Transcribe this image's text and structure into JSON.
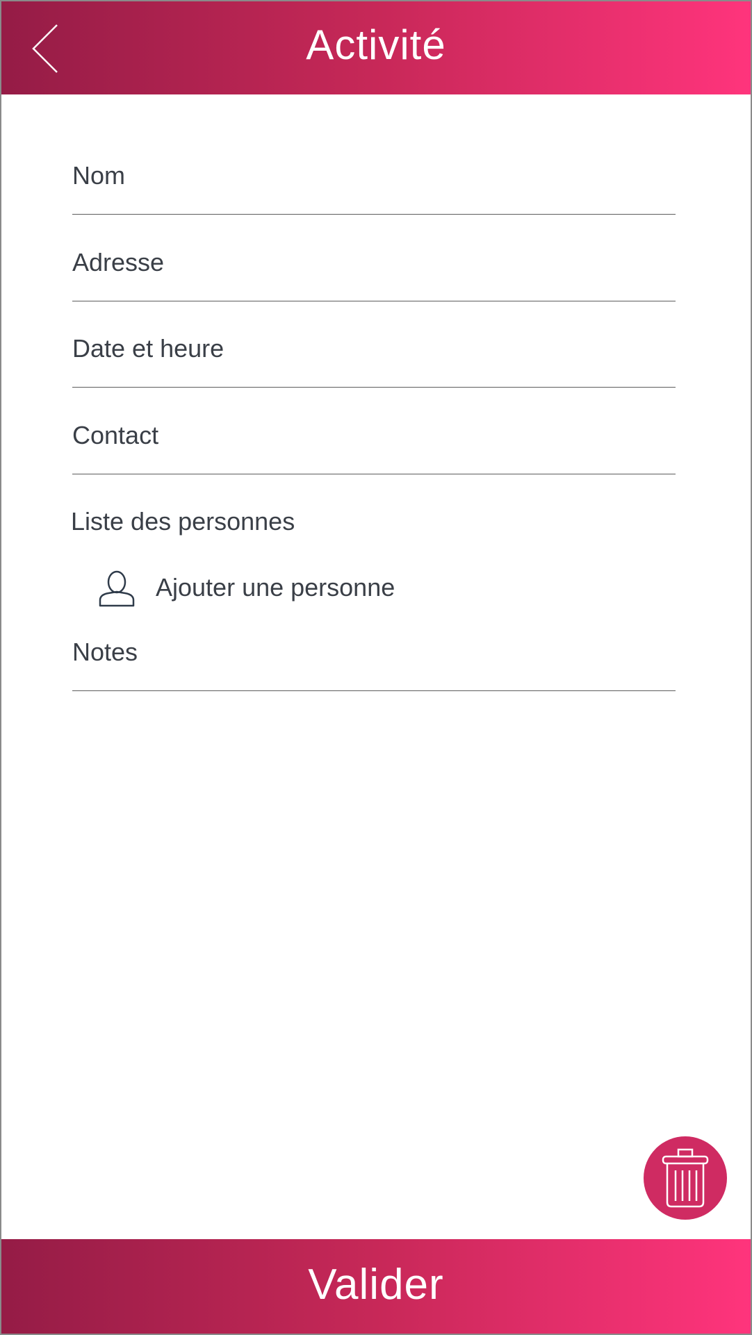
{
  "header": {
    "title": "Activité",
    "back_icon": "chevron-left-icon"
  },
  "form": {
    "fields": [
      {
        "label": "Nom"
      },
      {
        "label": "Adresse"
      },
      {
        "label": "Date et heure"
      },
      {
        "label": "Contact"
      }
    ],
    "people_section": {
      "label": "Liste des personnes",
      "add_label": "Ajouter une personne",
      "add_icon": "user-icon"
    },
    "notes": {
      "label": "Notes"
    }
  },
  "actions": {
    "delete_icon": "trash-icon",
    "submit_label": "Valider"
  },
  "colors": {
    "gradient_start": "#951c46",
    "gradient_end": "#ff347c",
    "accent": "#cf2b62",
    "text": "#3a3f47"
  }
}
